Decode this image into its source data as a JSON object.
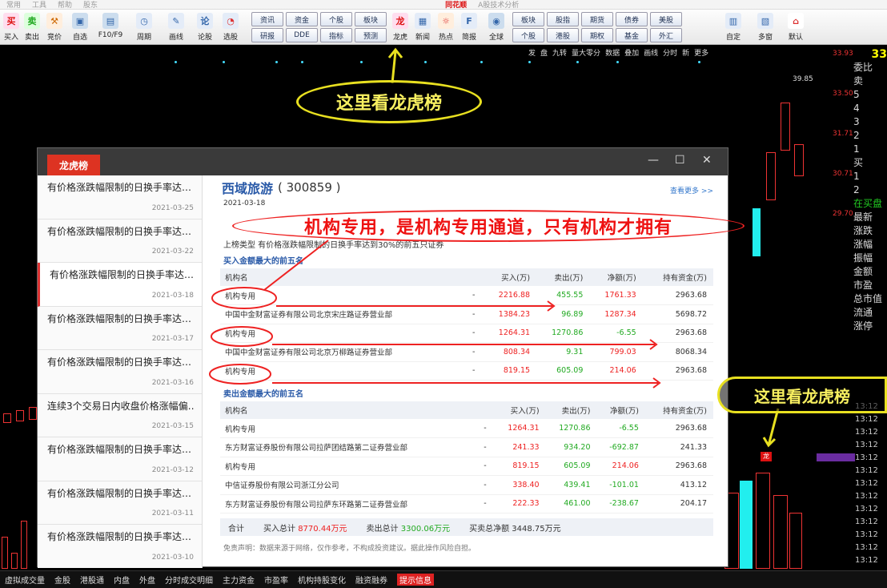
{
  "titlebar": {
    "items": [
      "常用",
      "工具",
      "帮助",
      "股东"
    ],
    "brand": "同花顺",
    "window_title": "A股技术分析"
  },
  "toolbar": {
    "left_buttons": [
      {
        "icon": "buy-icon",
        "label": "买入"
      },
      {
        "icon": "sell-icon",
        "label": "卖出"
      },
      {
        "icon": "auction-icon",
        "label": "竞价"
      },
      {
        "icon": "self-select-icon",
        "label": "自选"
      },
      {
        "icon": "f10-icon",
        "label": "F10/F9"
      },
      {
        "icon": "cycle-icon",
        "label": "周期"
      },
      {
        "icon": "draw-icon",
        "label": "画线"
      },
      {
        "icon": "stats-icon",
        "label": "论股"
      },
      {
        "icon": "select-icon",
        "label": "选股"
      }
    ],
    "grid1": [
      "资讯",
      "资金",
      "个股",
      "板块",
      "研报",
      "DDE",
      "指标",
      "预测"
    ],
    "mid_buttons": [
      {
        "icon": "dragon-icon",
        "label": "龙虎"
      },
      {
        "icon": "news-icon",
        "label": "新闻"
      },
      {
        "icon": "hot-icon",
        "label": "热点"
      },
      {
        "icon": "f-icon",
        "label": "简报"
      },
      {
        "icon": "globe-icon",
        "label": "全球"
      }
    ],
    "grid2": [
      "板块",
      "股指",
      "期货",
      "债券",
      "美股",
      "个股",
      "港股",
      "期权",
      "基金",
      "外汇"
    ],
    "right_buttons": [
      {
        "icon": "custom-icon",
        "label": "自定"
      },
      {
        "icon": "multi-icon",
        "label": "多窗"
      },
      {
        "icon": "home-icon",
        "label": "默认"
      }
    ]
  },
  "chart_bar": [
    "发",
    "盘",
    "九转",
    "量大零分",
    "数据",
    "叠加",
    "画线",
    "分时",
    "新",
    "更多"
  ],
  "right_scale": [
    "33.93",
    "33.50",
    "31.71",
    "30.71",
    "29.70"
  ],
  "price_label": "39.85",
  "right_panel": {
    "title": "33",
    "chars": [
      {
        "t": "委比",
        "c": ""
      },
      {
        "t": "卖",
        "c": ""
      },
      {
        "t": "5",
        "c": ""
      },
      {
        "t": "4",
        "c": ""
      },
      {
        "t": "3",
        "c": ""
      },
      {
        "t": "2",
        "c": ""
      },
      {
        "t": "1",
        "c": ""
      },
      {
        "t": "买",
        "c": ""
      },
      {
        "t": "1",
        "c": ""
      },
      {
        "t": "2",
        "c": ""
      },
      {
        "t": "在买盘",
        "c": "green"
      },
      {
        "t": "最新",
        "c": ""
      },
      {
        "t": "涨跌",
        "c": ""
      },
      {
        "t": "涨幅",
        "c": ""
      },
      {
        "t": "振幅",
        "c": ""
      },
      {
        "t": "金额",
        "c": ""
      },
      {
        "t": "市盈",
        "c": ""
      },
      {
        "t": "总市值",
        "c": ""
      },
      {
        "t": "流通",
        "c": ""
      },
      {
        "t": "涨停",
        "c": ""
      }
    ]
  },
  "time_col": [
    "13:12",
    "13:12",
    "13:12",
    "13:12",
    "13:12",
    "13:12",
    "13:12",
    "13:12",
    "13:12",
    "13:12",
    "13:12",
    "13:12",
    "13:12"
  ],
  "callouts": {
    "top": "这里看龙虎榜",
    "right": "这里看龙虎榜"
  },
  "red_note": "机构专用，是机构专用通道，只有机构才拥有",
  "dialog": {
    "tab": "龙虎榜",
    "controls": [
      "—",
      "☐",
      "✕"
    ],
    "list": [
      {
        "title": "有价格涨跌幅限制的日换手率达…",
        "date": "2021-03-25"
      },
      {
        "title": "有价格涨跌幅限制的日换手率达…",
        "date": "2021-03-22"
      },
      {
        "title": "有价格涨跌幅限制的日换手率达…",
        "date": "2021-03-18"
      },
      {
        "title": "有价格涨跌幅限制的日换手率达…",
        "date": "2021-03-17"
      },
      {
        "title": "有价格涨跌幅限制的日换手率达…",
        "date": "2021-03-16"
      },
      {
        "title": "连续3个交易日内收盘价格涨幅偏…",
        "date": "2021-03-15"
      },
      {
        "title": "有价格涨跌幅限制的日换手率达…",
        "date": "2021-03-12"
      },
      {
        "title": "有价格涨跌幅限制的日换手率达…",
        "date": "2021-03-11"
      },
      {
        "title": "有价格涨跌幅限制的日换手率达…",
        "date": "2021-03-10"
      }
    ],
    "stock_name": "西域旅游",
    "stock_code": "( 300859 )",
    "more_link": "查看更多 >>",
    "date_line": "2021-03-18",
    "reason": "上榜类型  有价格涨跌幅限制的日换手率达到30%的前五只证券",
    "buy_title": "买入金额最大的前五名",
    "sell_title": "卖出金额最大的前五名",
    "headers": [
      "机构名",
      "",
      "买入(万)",
      "卖出(万)",
      "净额(万)",
      "持有资金(万)"
    ],
    "buy_rows": [
      {
        "name": "机构专用",
        "dash": "-",
        "buy": "2216.88",
        "sell": "455.55",
        "net": "1761.33",
        "hold": "2963.68"
      },
      {
        "name": "中国中金财富证券有限公司北京宋庄路证券营业部",
        "dash": "-",
        "buy": "1384.23",
        "sell": "96.89",
        "net": "1287.34",
        "hold": "5698.72"
      },
      {
        "name": "机构专用",
        "dash": "-",
        "buy": "1264.31",
        "sell": "1270.86",
        "net": "-6.55",
        "hold": "2963.68"
      },
      {
        "name": "中国中金财富证券有限公司北京万柳路证券营业部",
        "dash": "-",
        "buy": "808.34",
        "sell": "9.31",
        "net": "799.03",
        "hold": "8068.34"
      },
      {
        "name": "机构专用",
        "dash": "-",
        "buy": "819.15",
        "sell": "605.09",
        "net": "214.06",
        "hold": "2963.68"
      }
    ],
    "sell_rows": [
      {
        "name": "机构专用",
        "dash": "-",
        "buy": "1264.31",
        "sell": "1270.86",
        "net": "-6.55",
        "hold": "2963.68"
      },
      {
        "name": "东方财富证券股份有限公司拉萨团结路第二证券营业部",
        "dash": "-",
        "buy": "241.33",
        "sell": "934.20",
        "net": "-692.87",
        "hold": "241.33"
      },
      {
        "name": "机构专用",
        "dash": "-",
        "buy": "819.15",
        "sell": "605.09",
        "net": "214.06",
        "hold": "2963.68"
      },
      {
        "name": "中信证券股份有限公司浙江分公司",
        "dash": "-",
        "buy": "338.40",
        "sell": "439.41",
        "net": "-101.01",
        "hold": "413.12"
      },
      {
        "name": "东方财富证券股份有限公司拉萨东环路第二证券营业部",
        "dash": "-",
        "buy": "222.33",
        "sell": "461.00",
        "net": "-238.67",
        "hold": "204.17"
      }
    ],
    "total": {
      "label": "合计",
      "buy_label": "买入总计",
      "buy": "8770.44万元",
      "sell_label": "卖出总计",
      "sell": "3300.06万元",
      "net_label": "买卖总净额",
      "net": "3448.75万元"
    },
    "disclaimer": "免责声明：数据来源于网络，仅作参考，不构成投资建议。据此操作风险自担。"
  },
  "status_bar": [
    "虚拟成交量",
    "金股",
    "港股通",
    "内盘",
    "外盘",
    "分时成交明细",
    "主力资金",
    "市盈率",
    "机构持股变化",
    "融资融券",
    "提示信息"
  ],
  "colors": {
    "accent": "#d32222",
    "brand_blue": "#2a5aa8",
    "callout_yellow": "#e8e020",
    "buy_red": "#e22222",
    "sell_green": "#22aa22"
  }
}
